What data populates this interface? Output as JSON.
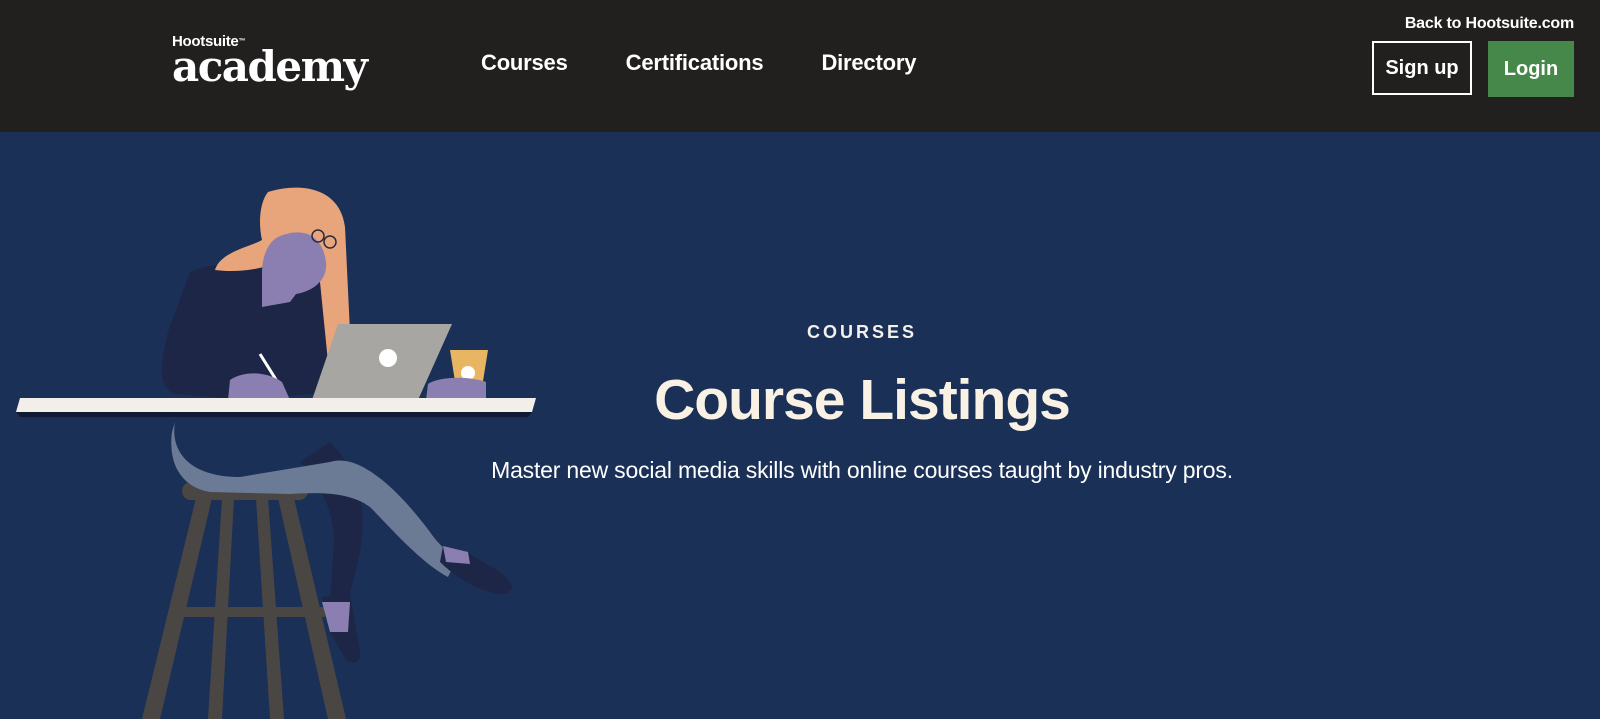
{
  "header": {
    "logo_small": "Hootsuite",
    "logo_big": "academy",
    "nav": [
      {
        "label": "Courses"
      },
      {
        "label": "Certifications"
      },
      {
        "label": "Directory"
      }
    ],
    "back_link": "Back to Hootsuite.com",
    "signup_label": "Sign up",
    "login_label": "Login"
  },
  "hero": {
    "eyebrow": "COURSES",
    "title": "Course Listings",
    "subtitle": "Master new social media skills with online courses taught by industry pros."
  },
  "colors": {
    "header_bg": "#221f1f",
    "hero_bg": "#1a3057",
    "login_green": "#46884a"
  }
}
